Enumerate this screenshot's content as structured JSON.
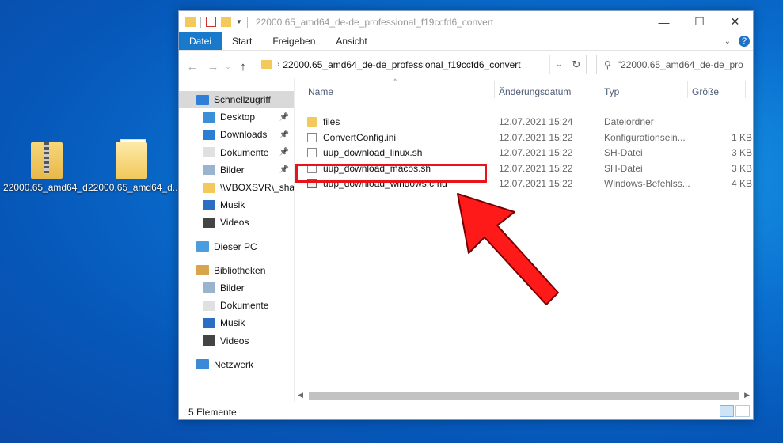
{
  "desktop": {
    "icons": [
      {
        "label": "22000.65_amd64_d...",
        "icon": "zip-folder-icon"
      },
      {
        "label": "22000.65_amd64_d...",
        "icon": "folder-icon"
      }
    ]
  },
  "window": {
    "title": "22000.65_amd64_de-de_professional_f19ccfd6_convert",
    "controls": {
      "minimize": "—",
      "maximize": "☐",
      "close": "✕"
    }
  },
  "ribbon": {
    "tabs": [
      "Datei",
      "Start",
      "Freigeben",
      "Ansicht"
    ],
    "help": "?"
  },
  "address": {
    "path": "22000.65_amd64_de-de_professional_f19ccfd6_convert",
    "search_placeholder": "\"22000.65_amd64_de-de_pro..."
  },
  "nav": {
    "items": [
      {
        "label": "Schnellzugriff",
        "icon": "star-icon",
        "level": 0,
        "pinned": false,
        "selected": true
      },
      {
        "label": "Desktop",
        "icon": "desktop-icon",
        "level": 1,
        "pinned": true
      },
      {
        "label": "Downloads",
        "icon": "download-icon",
        "level": 1,
        "pinned": true
      },
      {
        "label": "Dokumente",
        "icon": "documents-icon",
        "level": 1,
        "pinned": true
      },
      {
        "label": "Bilder",
        "icon": "pictures-icon",
        "level": 1,
        "pinned": true
      },
      {
        "label": "\\\\VBOXSVR\\_shared",
        "icon": "network-drive-icon",
        "level": 1,
        "pinned": false
      },
      {
        "label": "Musik",
        "icon": "music-icon",
        "level": 1,
        "pinned": false
      },
      {
        "label": "Videos",
        "icon": "videos-icon",
        "level": 1,
        "pinned": false
      },
      {
        "label": "",
        "icon": "",
        "level": -1
      },
      {
        "label": "Dieser PC",
        "icon": "pc-icon",
        "level": 0,
        "pinned": false
      },
      {
        "label": "",
        "icon": "",
        "level": -1
      },
      {
        "label": "Bibliotheken",
        "icon": "libraries-icon",
        "level": 0,
        "pinned": false
      },
      {
        "label": "Bilder",
        "icon": "pictures-icon",
        "level": 1,
        "pinned": false
      },
      {
        "label": "Dokumente",
        "icon": "documents-icon",
        "level": 1,
        "pinned": false
      },
      {
        "label": "Musik",
        "icon": "music-icon",
        "level": 1,
        "pinned": false
      },
      {
        "label": "Videos",
        "icon": "videos-icon",
        "level": 1,
        "pinned": false
      },
      {
        "label": "",
        "icon": "",
        "level": -1
      },
      {
        "label": "Netzwerk",
        "icon": "network-icon",
        "level": 0,
        "pinned": false
      }
    ]
  },
  "columns": {
    "name": "Name",
    "date": "Änderungsdatum",
    "type": "Typ",
    "size": "Größe"
  },
  "files": [
    {
      "name": "files",
      "date": "12.07.2021 15:24",
      "type": "Dateiordner",
      "size": "",
      "icon": "folder-icon"
    },
    {
      "name": "ConvertConfig.ini",
      "date": "12.07.2021 15:22",
      "type": "Konfigurationsein...",
      "size": "1 KB",
      "icon": "config-file-icon"
    },
    {
      "name": "uup_download_linux.sh",
      "date": "12.07.2021 15:22",
      "type": "SH-Datei",
      "size": "3 KB",
      "icon": "file-icon"
    },
    {
      "name": "uup_download_macos.sh",
      "date": "12.07.2021 15:22",
      "type": "SH-Datei",
      "size": "3 KB",
      "icon": "file-icon"
    },
    {
      "name": "uup_download_windows.cmd",
      "date": "12.07.2021 15:22",
      "type": "Windows-Befehlss...",
      "size": "4 KB",
      "icon": "cmd-file-icon"
    }
  ],
  "status": {
    "count": "5 Elemente"
  },
  "colors": {
    "accent": "#1979ca",
    "highlight": "#e8141c",
    "folder": "#f2c95a"
  }
}
